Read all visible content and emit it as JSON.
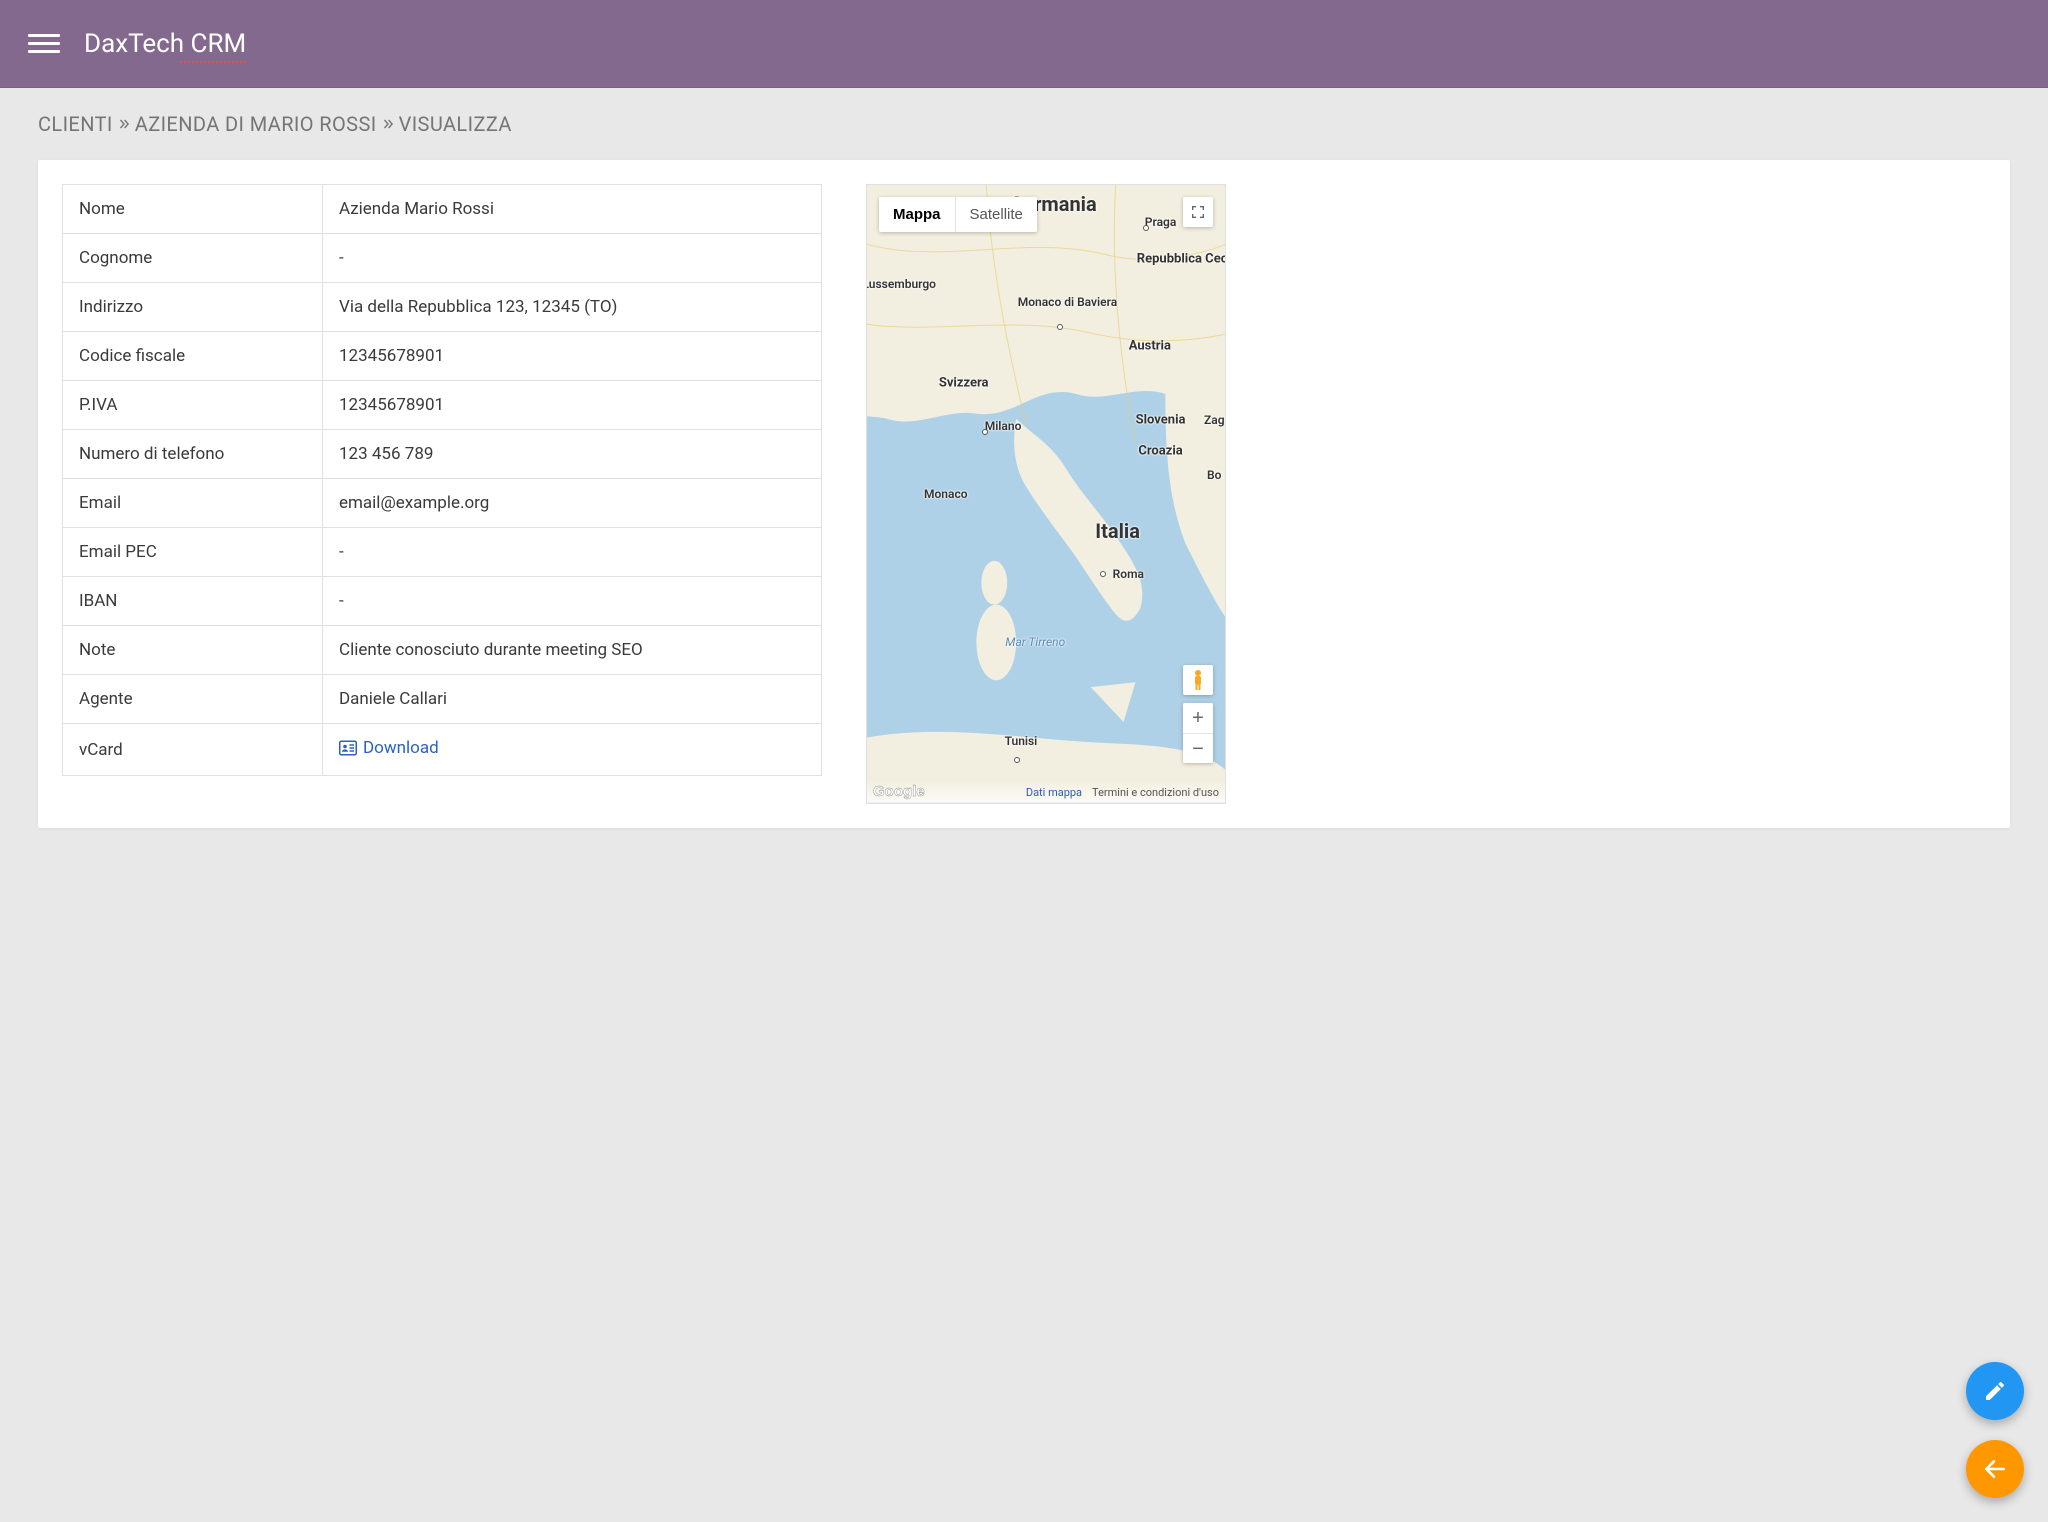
{
  "header": {
    "app_title": "DaxTech CRM"
  },
  "breadcrumb": {
    "items": [
      "CLIENTI",
      "AZIENDA DI MARIO ROSSI",
      "VISUALIZZA"
    ]
  },
  "details": {
    "rows": [
      {
        "label": "Nome",
        "value": "Azienda Mario Rossi"
      },
      {
        "label": "Cognome",
        "value": "-"
      },
      {
        "label": "Indirizzo",
        "value": "Via della Repubblica 123, 12345 (TO)"
      },
      {
        "label": "Codice fiscale",
        "value": "12345678901"
      },
      {
        "label": "P.IVA",
        "value": "12345678901"
      },
      {
        "label": "Numero di telefono",
        "value": "123 456 789"
      },
      {
        "label": "Email",
        "value": "email@example.org"
      },
      {
        "label": "Email PEC",
        "value": "-"
      },
      {
        "label": "IBAN",
        "value": "-"
      },
      {
        "label": "Note",
        "value": "Cliente conosciuto durante meeting SEO"
      },
      {
        "label": "Agente",
        "value": "Daniele Callari"
      }
    ],
    "vcard_label": "vCard",
    "vcard_download": "Download"
  },
  "map": {
    "type_map": "Mappa",
    "type_sat": "Satellite",
    "footer_data": "Dati mappa",
    "footer_terms": "Termini e condizioni d'uso",
    "google_label": "Google",
    "labels": {
      "germania": "Germania",
      "italia": "Italia",
      "austria": "Austria",
      "svizzera": "Svizzera",
      "slovenia": "Slovenia",
      "croazia": "Croazia",
      "lussemburgo": "Lussemburgo",
      "repubblica_ceca": "Repubblica Ceca",
      "monaco_baviera": "Monaco di Baviera",
      "praga": "Praga",
      "milano": "Milano",
      "roma": "Roma",
      "monaco": "Monaco",
      "tunisi": "Tunisi",
      "zag": "Zag",
      "bo": "Bo",
      "mar_tirreno": "Mar Tirreno"
    }
  }
}
